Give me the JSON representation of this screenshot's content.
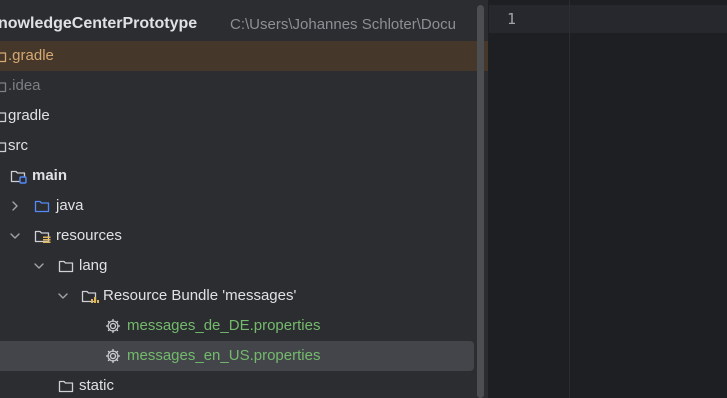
{
  "project": {
    "name": "nowledgeCenterPrototype",
    "path": "C:\\Users\\Johannes Schloter\\Docu"
  },
  "tree": {
    "gradle_hidden": ".gradle",
    "idea": ".idea",
    "gradle": "gradle",
    "src": "src",
    "main": "main",
    "java": "java",
    "resources": "resources",
    "lang": "lang",
    "resource_bundle": "Resource Bundle 'messages'",
    "file_de": "messages_de_DE.properties",
    "file_en": "messages_en_US.properties",
    "static": "static"
  },
  "editor": {
    "line_number": "1"
  },
  "colors": {
    "panel_bg": "#2b2d30",
    "editor_bg": "#1e1f22",
    "selected_row": "#43454a",
    "excluded_row": "#45372a",
    "vcs_added_green": "#74ba6d",
    "excluded_orange": "#d6a872"
  },
  "icons": {
    "folder": "folder-icon",
    "source_folder": "source-folder-icon",
    "resources_folder": "resources-folder-icon",
    "module_folder": "module-folder-icon",
    "resource_bundle": "resource-bundle-icon",
    "properties": "gear-icon",
    "chevron_right": "chevron-right-icon",
    "chevron_down": "chevron-down-icon"
  }
}
